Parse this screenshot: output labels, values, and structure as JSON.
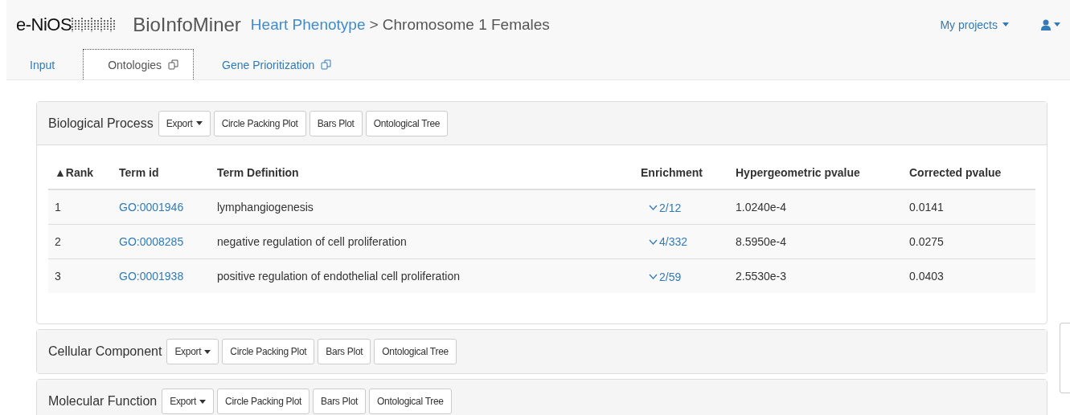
{
  "navbar": {
    "logo": "e-NiOS",
    "app_name": "BioInfoMiner",
    "breadcrumb_link": "Heart Phenotype",
    "breadcrumb_rest": "> Chromosome 1 Females",
    "menu": "My projects"
  },
  "tabs": [
    {
      "label": "Input",
      "selected": false,
      "popout": false
    },
    {
      "label": "Ontologies",
      "selected": true,
      "popout": true
    },
    {
      "label": "Gene Prioritization",
      "selected": false,
      "popout": true
    }
  ],
  "panels": [
    {
      "title": "Biological Process",
      "buttons": [
        "Export",
        "Circle Packing Plot",
        "Bars Plot",
        "Ontological Tree"
      ],
      "expanded": true,
      "table": {
        "columns": [
          "▲Rank",
          "Term id",
          "Term Definition",
          "Enrichment",
          "Hypergeometric pvalue",
          "Corrected pvalue"
        ],
        "rows": [
          [
            "1",
            "GO:0001946",
            "lymphangiogenesis",
            "2/12",
            "1.0240e-4",
            "0.0141"
          ],
          [
            "2",
            "GO:0008285",
            "negative regulation of cell proliferation",
            "4/332",
            "8.5950e-4",
            "0.0275"
          ],
          [
            "3",
            "GO:0001938",
            "positive regulation of endothelial cell proliferation",
            "2/59",
            "2.5530e-3",
            "0.0403"
          ]
        ]
      }
    },
    {
      "title": "Cellular Component",
      "buttons": [
        "Export",
        "Circle Packing Plot",
        "Bars Plot",
        "Ontological Tree"
      ],
      "expanded": false
    },
    {
      "title": "Molecular Function",
      "buttons": [
        "Export",
        "Circle Packing Plot",
        "Bars Plot",
        "Ontological Tree"
      ],
      "expanded": false
    }
  ]
}
